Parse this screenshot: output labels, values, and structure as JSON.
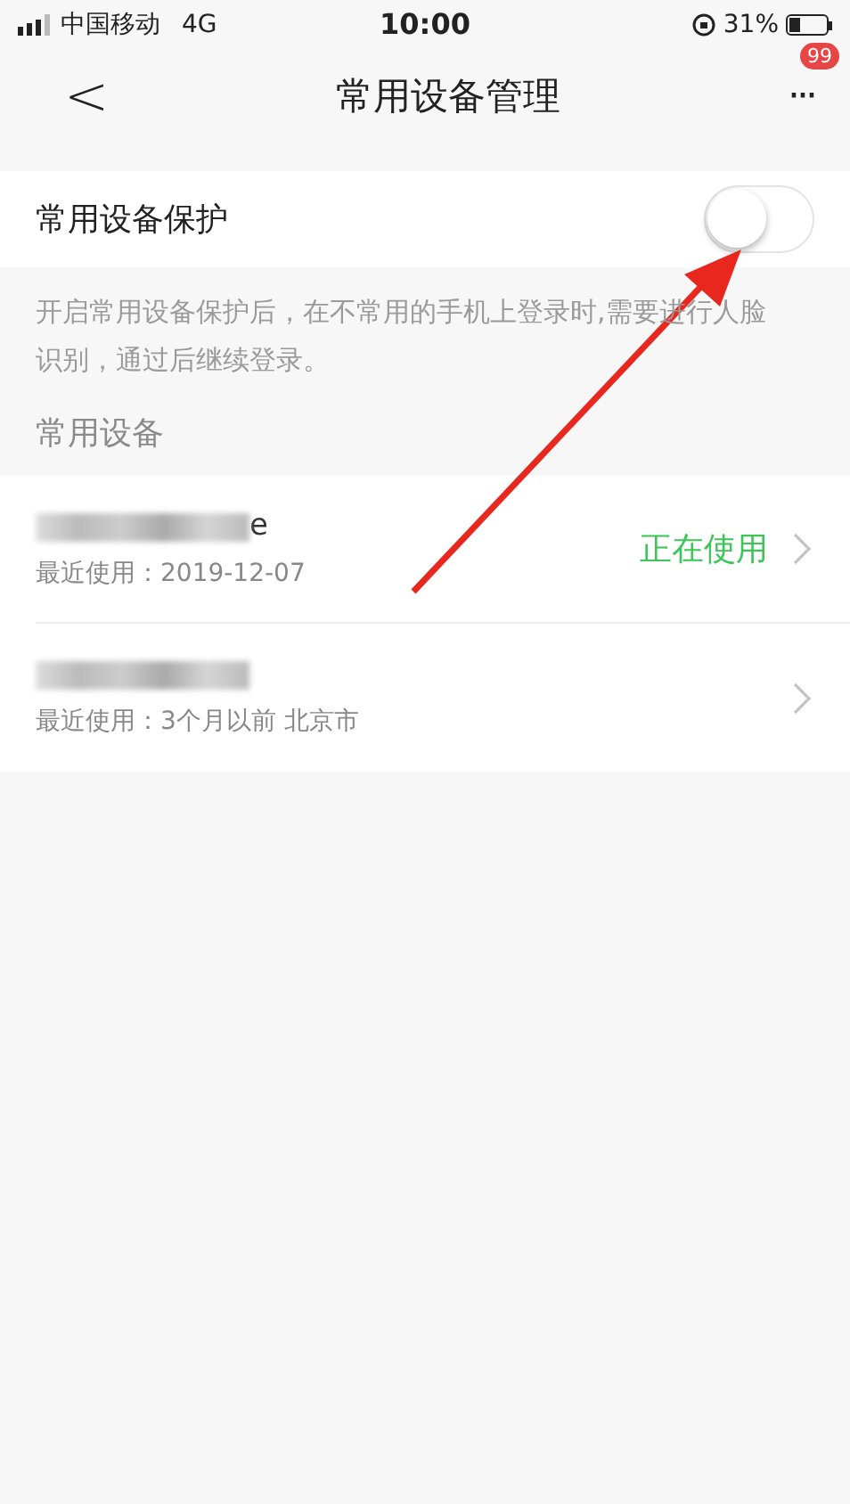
{
  "status_bar": {
    "carrier": "中国移动",
    "network": "4G",
    "time": "10:00",
    "battery": "31%"
  },
  "nav": {
    "back": "<",
    "title": "常用设备管理",
    "more": "···",
    "badge": "99"
  },
  "protection": {
    "label": "常用设备保护",
    "on": false
  },
  "description": "开启常用设备保护后，在不常用的手机上登录时,需要进行人脸识别，通过后继续登录。",
  "section_title": "常用设备",
  "devices": [
    {
      "name_visible": "e",
      "redacted": true,
      "last_used": "最近使用：2019-12-07",
      "status": "正在使用"
    },
    {
      "redacted": true,
      "last_used": "最近使用：3个月以前 北京市"
    }
  ]
}
